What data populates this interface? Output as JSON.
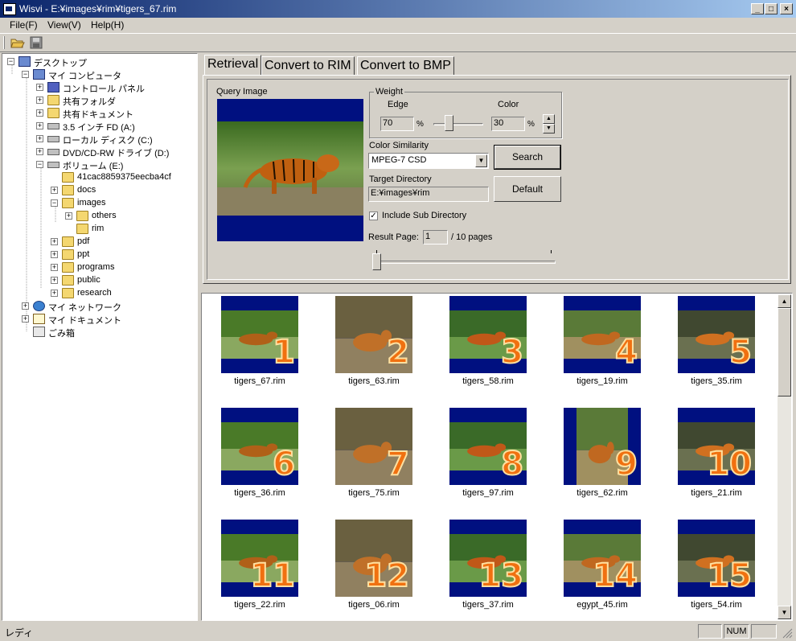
{
  "window": {
    "title": "Wisvi - E:¥images¥rim¥tigers_67.rim"
  },
  "menu": [
    "File(F)",
    "View(V)",
    "Help(H)"
  ],
  "toolbar": {
    "open_icon": "open-folder-icon",
    "save_icon": "save-disk-icon"
  },
  "tree": [
    {
      "label": "デスクトップ",
      "icon": "desktop",
      "expander": "−"
    },
    {
      "label": "マイ コンピュータ",
      "icon": "pc",
      "expander": "−"
    },
    {
      "label": "コントロール パネル",
      "icon": "ctrl",
      "expander": "+"
    },
    {
      "label": "共有フォルダ",
      "icon": "folder",
      "expander": "+"
    },
    {
      "label": "共有ドキュメント",
      "icon": "folder",
      "expander": "+"
    },
    {
      "label": "3.5 インチ FD (A:)",
      "icon": "drive",
      "expander": "+"
    },
    {
      "label": "ローカル ディスク (C:)",
      "icon": "drive",
      "expander": "+"
    },
    {
      "label": "DVD/CD-RW ドライブ (D:)",
      "icon": "drive",
      "expander": "+"
    },
    {
      "label": "ボリューム (E:)",
      "icon": "drive",
      "expander": "−"
    },
    {
      "label": "41cac8859375eecba4cf",
      "icon": "folder",
      "expander": ""
    },
    {
      "label": "docs",
      "icon": "folder",
      "expander": "+"
    },
    {
      "label": "images",
      "icon": "folder",
      "expander": "−"
    },
    {
      "label": "others",
      "icon": "folder",
      "expander": "+"
    },
    {
      "label": "rim",
      "icon": "folder",
      "expander": ""
    },
    {
      "label": "pdf",
      "icon": "folder",
      "expander": "+"
    },
    {
      "label": "ppt",
      "icon": "folder",
      "expander": "+"
    },
    {
      "label": "programs",
      "icon": "folder",
      "expander": "+"
    },
    {
      "label": "public",
      "icon": "folder",
      "expander": "+"
    },
    {
      "label": "research",
      "icon": "folder",
      "expander": "+"
    },
    {
      "label": "マイ ネットワーク",
      "icon": "globe",
      "expander": "+"
    },
    {
      "label": "マイ ドキュメント",
      "icon": "doc",
      "expander": "+"
    },
    {
      "label": "ごみ箱",
      "icon": "trash",
      "expander": ""
    }
  ],
  "tabs": [
    "Retrieval",
    "Convert to RIM",
    "Convert to BMP"
  ],
  "retrieval": {
    "query_image_label": "Query Image",
    "weight_label": "Weight",
    "edge_label": "Edge",
    "color_label": "Color",
    "edge_value": "70",
    "color_value": "30",
    "percent": "%",
    "edge_weight_fraction": 0.7,
    "color_similarity_label": "Color Similarity",
    "color_similarity_value": "MPEG-7 CSD",
    "search_button": "Search",
    "target_directory_label": "Target Directory",
    "target_directory_value": "E:¥images¥rim",
    "default_button": "Default",
    "include_sub_label": "Include Sub Directory",
    "include_sub_checked": true,
    "result_page_label": "Result Page:",
    "result_page_value": "1",
    "result_page_total": "/ 10 pages",
    "result_page_fraction": 0.0
  },
  "results": [
    {
      "name": "tigers_67.rim",
      "num": "1",
      "style": "wide"
    },
    {
      "name": "tigers_63.rim",
      "num": "2",
      "style": "full"
    },
    {
      "name": "tigers_58.rim",
      "num": "3",
      "style": "wide"
    },
    {
      "name": "tigers_19.rim",
      "num": "4",
      "style": "wide"
    },
    {
      "name": "tigers_35.rim",
      "num": "5",
      "style": "wide"
    },
    {
      "name": "tigers_36.rim",
      "num": "6",
      "style": "wide"
    },
    {
      "name": "tigers_75.rim",
      "num": "7",
      "style": "full"
    },
    {
      "name": "tigers_97.rim",
      "num": "8",
      "style": "wide"
    },
    {
      "name": "tigers_62.rim",
      "num": "9",
      "style": "tall"
    },
    {
      "name": "tigers_21.rim",
      "num": "10",
      "style": "wide"
    },
    {
      "name": "tigers_22.rim",
      "num": "11",
      "style": "wide"
    },
    {
      "name": "tigers_06.rim",
      "num": "12",
      "style": "full"
    },
    {
      "name": "tigers_37.rim",
      "num": "13",
      "style": "wide"
    },
    {
      "name": "egypt_45.rim",
      "num": "14",
      "style": "wide"
    },
    {
      "name": "tigers_54.rim",
      "num": "15",
      "style": "wide"
    }
  ],
  "status": {
    "text": "レディ",
    "num": "NUM"
  }
}
